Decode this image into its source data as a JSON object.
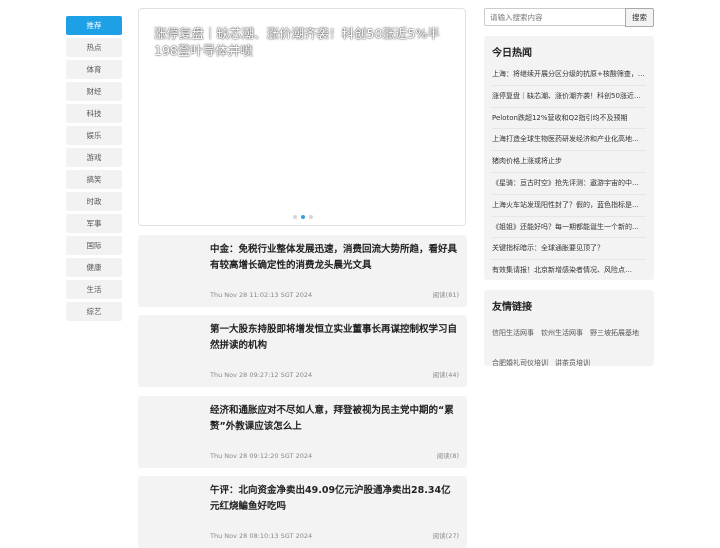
{
  "nav": [
    {
      "label": "推荐",
      "active": true
    },
    {
      "label": "热点"
    },
    {
      "label": "体育"
    },
    {
      "label": "财经"
    },
    {
      "label": "科技"
    },
    {
      "label": "娱乐"
    },
    {
      "label": "游戏"
    },
    {
      "label": "搞笑"
    },
    {
      "label": "时政"
    },
    {
      "label": "军事"
    },
    {
      "label": "国际"
    },
    {
      "label": "健康"
    },
    {
      "label": "生活"
    },
    {
      "label": "综艺"
    }
  ],
  "banner": {
    "title": "涨停复盘｜缺芯潮、涨价潮齐袭！科创50涨近5%半导体等1983股上涨",
    "title_display": "涨停复盘｜缺芯潮、涨价潮齐袭！科创50涨近5%半198登叶导体井喷",
    "active_dot": 1,
    "dot_count": 3
  },
  "articles": [
    {
      "title": "中金：免税行业整体发展迅速，消费回流大势所趋，看好具有较高增长确定性的消费龙头晨光文具",
      "date": "Thu Nov 28 11:02:13 SGT 2024",
      "reads": "阅读(81)"
    },
    {
      "title": "第一大股东持股即将增发恒立实业董事长再谋控制权学习自然拼读的机构",
      "date": "Thu Nov 28 09:27:12 SGT 2024",
      "reads": "阅读(44)"
    },
    {
      "title": "经济和通胀应对不尽如人意，拜登被视为民主党中期的“累赘”外教课应该怎么上",
      "date": "Thu Nov 28 09:12:20 SGT 2024",
      "reads": "阅读(8)"
    },
    {
      "title": "午评：北向资金净卖出49.09亿元沪股通净卖出28.34亿元红烧鳊鱼好吃吗",
      "date": "Thu Nov 28 08:10:13 SGT 2024",
      "reads": "阅读(27)"
    }
  ],
  "search": {
    "placeholder": "请输入搜索内容",
    "button": "搜索"
  },
  "hot": {
    "title": "今日热闻",
    "items": [
      "上海：将继续开展分区分级的抗原+核酸筛查，…",
      "涨停复盘｜缺芯潮、涨价潮齐袭！科创50涨近…",
      "Peloton跌超12%营收和Q2指引均不及预期",
      "上海打造全球生物医药研发经济和产业化高地…",
      "猪肉价格上涨或将止步",
      "《星骑：亘古时空》抢先评测：遨游宇宙的中…",
      "上海火车站发现阳性封了？假的，蓝色指标是…",
      "《姐姐》还能好吗？每一期都能诞生一个新的…",
      "关键指标暗示：全球通胀要见顶了？",
      "有效集请报！北京新增感染者情况、风险点…"
    ]
  },
  "friends": {
    "title": "友情链接",
    "links": [
      "信阳生活网事",
      "钦州生活网事",
      "野三坡拓展基地",
      "合肥婚礼司仪培训",
      "讲茶员培训"
    ]
  }
}
